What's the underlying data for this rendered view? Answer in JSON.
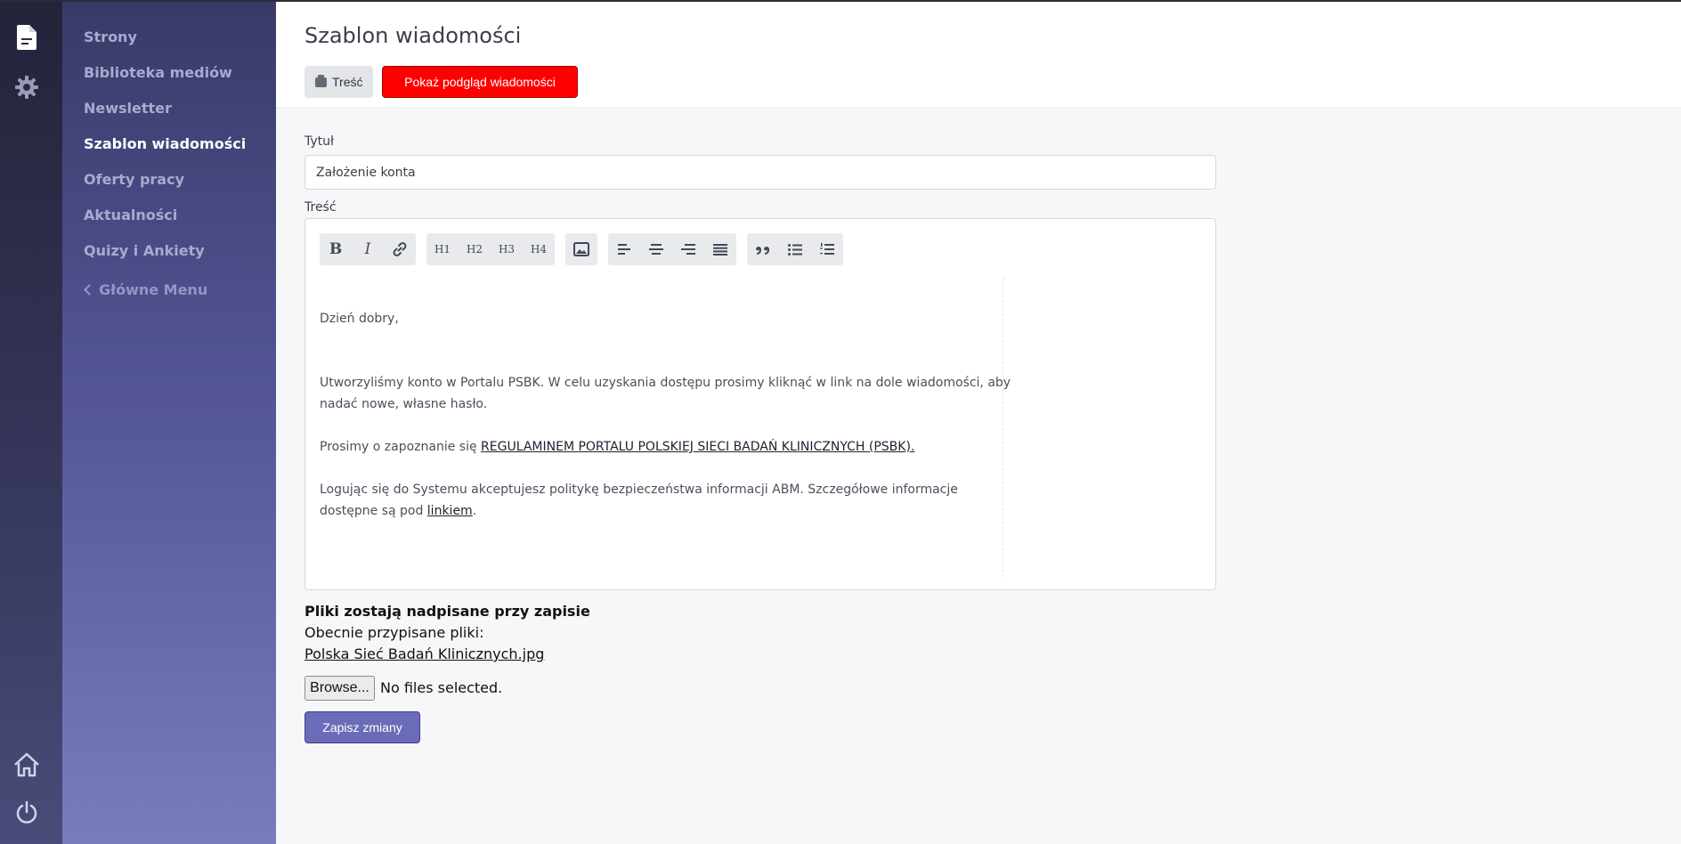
{
  "sidebar": {
    "items": [
      {
        "label": "Strony"
      },
      {
        "label": "Biblioteka mediów"
      },
      {
        "label": "Newsletter"
      },
      {
        "label": "Szablon wiadomości"
      },
      {
        "label": "Oferty pracy"
      },
      {
        "label": "Aktualności"
      },
      {
        "label": "Quizy i Ankiety"
      }
    ],
    "back_label": "Główne Menu",
    "active_index": 3
  },
  "rail": {
    "icons": [
      "document-icon",
      "gear-icon",
      "home-icon",
      "power-icon"
    ]
  },
  "header": {
    "title": "Szablon wiadomości",
    "tab_label": "Treść",
    "preview_label": "Pokaż podgląd wiadomości"
  },
  "form": {
    "title_label": "Tytuł",
    "title_value": "Założenie konta",
    "content_label": "Treść"
  },
  "toolbar": {
    "bold": "B",
    "italic": "I",
    "h1": "H1",
    "h2": "H2",
    "h3": "H3",
    "h4": "H4"
  },
  "editor": {
    "greeting": "Dzień dobry,",
    "para1_line1": "Utworzyliśmy konto w Portalu PSBK. W celu uzyskania dostępu prosimy kliknąć w link na dole wiadomości, aby",
    "para1_line2": "nadać nowe, własne hasło.",
    "para2_prefix": "Prosimy o zapoznanie się ",
    "para2_link": "REGULAMINEM PORTALU POLSKIEJ SIECI BADAŃ KLINICZNYCH (PSBK). ",
    "para3_line1": "Logując się do Systemu akceptujesz politykę bezpieczeństwa informacji ABM. Szczegółowe informacje",
    "para3_prefix": "dostępne są pod ",
    "para3_link": "linkiem",
    "para3_suffix": "."
  },
  "files": {
    "title": "Pliki zostają nadpisane przy zapisie",
    "subtitle": "Obecnie przypisane pliki:",
    "file_name": "Polska Sieć Badań Klinicznych.jpg",
    "browse_label": "Browse...",
    "no_files_label": "No files selected."
  },
  "actions": {
    "save_label": "Zapisz zmiany"
  },
  "colors": {
    "preview_button": "#ff0000",
    "save_button": "#6b6cb7",
    "sidebar_top": "#393a67",
    "sidebar_bottom": "#7a7bbf"
  }
}
